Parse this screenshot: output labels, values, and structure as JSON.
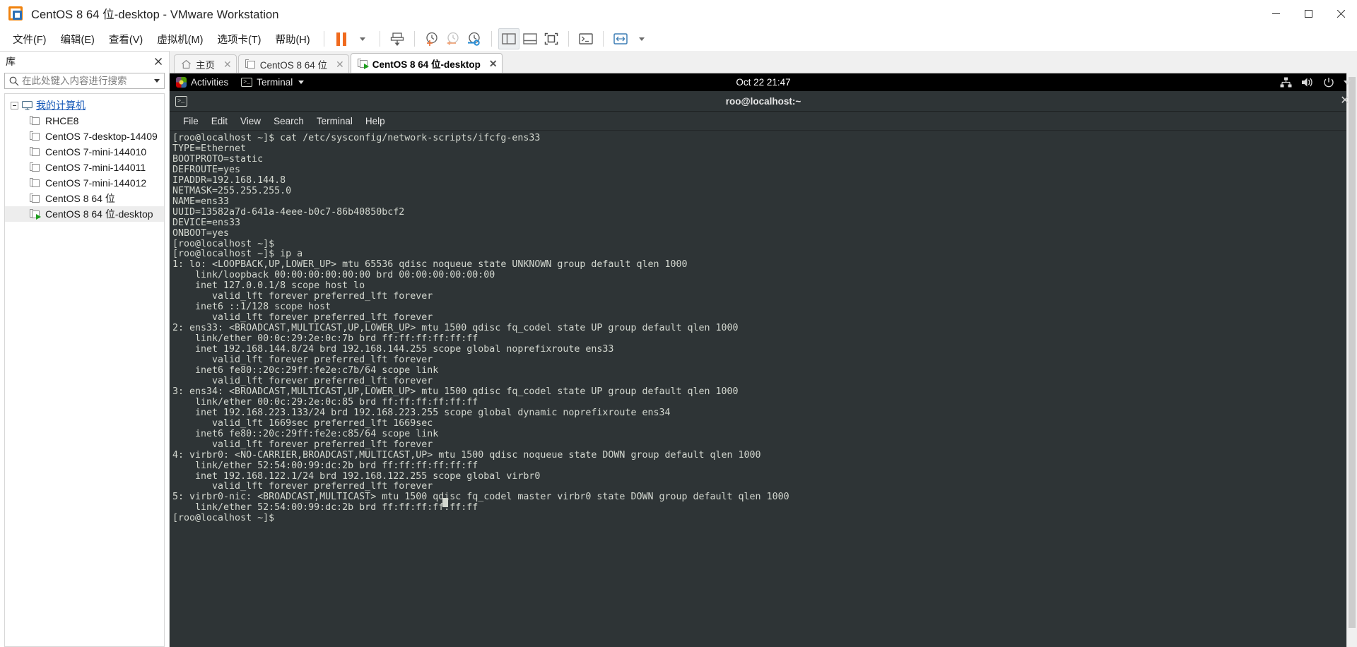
{
  "window": {
    "title": "CentOS 8 64 位-desktop - VMware Workstation",
    "app_icon": "vmware-logo-icon",
    "buttons": {
      "minimize": "minimize-icon",
      "maximize": "maximize-icon",
      "close": "close-icon"
    }
  },
  "menubar": {
    "items": [
      {
        "label": "文件(F)",
        "name": "menu-file"
      },
      {
        "label": "编辑(E)",
        "name": "menu-edit"
      },
      {
        "label": "查看(V)",
        "name": "menu-view"
      },
      {
        "label": "虚拟机(M)",
        "name": "menu-vm"
      },
      {
        "label": "选项卡(T)",
        "name": "menu-tabs"
      },
      {
        "label": "帮助(H)",
        "name": "menu-help"
      }
    ],
    "toolbar": [
      {
        "name": "suspend-button",
        "icon": "pause-icon"
      },
      {
        "name": "power-dropdown",
        "icon": "chevron-down-icon"
      },
      {
        "name": "manage-snapshot-button",
        "icon": "snapshot-save-icon"
      },
      {
        "name": "take-snapshot-button",
        "icon": "clock-plus-icon"
      },
      {
        "name": "revert-snapshot-button",
        "icon": "clock-back-icon"
      },
      {
        "name": "snapshot-manager-button",
        "icon": "clock-wrench-icon"
      },
      {
        "name": "show-library-button",
        "icon": "sidebar-panel-icon"
      },
      {
        "name": "show-console-view-button",
        "icon": "bottom-panel-icon"
      },
      {
        "name": "fullscreen-button",
        "icon": "fullscreen-icon"
      },
      {
        "name": "unity-mode-button",
        "icon": "console-icon"
      },
      {
        "name": "stretch-guest-button",
        "icon": "expand-arrows-icon"
      },
      {
        "name": "stretch-dropdown",
        "icon": "chevron-down-icon"
      }
    ]
  },
  "library": {
    "header": "库",
    "close_icon": "close-icon",
    "search": {
      "placeholder": "在此处键入内容进行搜索",
      "value": "",
      "icon": "search-icon",
      "dropdown_icon": "chevron-down-icon"
    },
    "root": {
      "label": "我的计算机",
      "icon": "computer-icon"
    },
    "items": [
      {
        "label": "RHCE8",
        "running": false
      },
      {
        "label": "CentOS 7-desktop-14409",
        "running": false
      },
      {
        "label": "CentOS 7-mini-144010",
        "running": false
      },
      {
        "label": "CentOS 7-mini-144011",
        "running": false
      },
      {
        "label": "CentOS 7-mini-144012",
        "running": false
      },
      {
        "label": "CentOS 8 64 位",
        "running": false
      },
      {
        "label": "CentOS 8 64 位-desktop",
        "running": true
      }
    ]
  },
  "tabs": [
    {
      "label": "主页",
      "icon": "home-icon",
      "active": false,
      "close_icon": "close-icon"
    },
    {
      "label": "CentOS 8 64 位",
      "icon": "vm-icon",
      "active": false,
      "close_icon": "close-icon"
    },
    {
      "label": "CentOS 8 64 位-desktop",
      "icon": "vm-running-icon",
      "active": true,
      "close_icon": "close-icon"
    }
  ],
  "gnome": {
    "activities": "Activities",
    "app_menu": "Terminal",
    "app_menu_caret": "chevron-down-icon",
    "clock": "Oct 22  21:47",
    "tray": [
      {
        "name": "network-icon"
      },
      {
        "name": "volume-icon"
      },
      {
        "name": "power-icon"
      },
      {
        "name": "chevron-down-icon"
      }
    ]
  },
  "terminal": {
    "title": "roo@localhost:~",
    "title_icon": "terminal-icon",
    "close_icon": "close-icon",
    "menu": [
      "File",
      "Edit",
      "View",
      "Search",
      "Terminal",
      "Help"
    ],
    "content": "[roo@localhost ~]$ cat /etc/sysconfig/network-scripts/ifcfg-ens33\nTYPE=Ethernet\nBOOTPROTO=static\nDEFROUTE=yes\nIPADDR=192.168.144.8\nNETMASK=255.255.255.0\nNAME=ens33\nUUID=13582a7d-641a-4eee-b0c7-86b40850bcf2\nDEVICE=ens33\nONBOOT=yes\n[roo@localhost ~]$ \n[roo@localhost ~]$ ip a\n1: lo: <LOOPBACK,UP,LOWER_UP> mtu 65536 qdisc noqueue state UNKNOWN group default qlen 1000\n    link/loopback 00:00:00:00:00:00 brd 00:00:00:00:00:00\n    inet 127.0.0.1/8 scope host lo\n       valid_lft forever preferred_lft forever\n    inet6 ::1/128 scope host\n       valid_lft forever preferred_lft forever\n2: ens33: <BROADCAST,MULTICAST,UP,LOWER_UP> mtu 1500 qdisc fq_codel state UP group default qlen 1000\n    link/ether 00:0c:29:2e:0c:7b brd ff:ff:ff:ff:ff:ff\n    inet 192.168.144.8/24 brd 192.168.144.255 scope global noprefixroute ens33\n       valid_lft forever preferred_lft forever\n    inet6 fe80::20c:29ff:fe2e:c7b/64 scope link\n       valid_lft forever preferred_lft forever\n3: ens34: <BROADCAST,MULTICAST,UP,LOWER_UP> mtu 1500 qdisc fq_codel state UP group default qlen 1000\n    link/ether 00:0c:29:2e:0c:85 brd ff:ff:ff:ff:ff:ff\n    inet 192.168.223.133/24 brd 192.168.223.255 scope global dynamic noprefixroute ens34\n       valid_lft 1669sec preferred_lft 1669sec\n    inet6 fe80::20c:29ff:fe2e:c85/64 scope link\n       valid_lft forever preferred_lft forever\n4: virbr0: <NO-CARRIER,BROADCAST,MULTICAST,UP> mtu 1500 qdisc noqueue state DOWN group default qlen 1000\n    link/ether 52:54:00:99:dc:2b brd ff:ff:ff:ff:ff:ff\n    inet 192.168.122.1/24 brd 192.168.122.255 scope global virbr0\n       valid_lft forever preferred_lft forever\n5: virbr0-nic: <BROADCAST,MULTICAST> mtu 1500 qdisc fq_codel master virbr0 state DOWN group default qlen 1000\n    link/ether 52:54:00:99:dc:2b brd ff:ff:ff:ff:ff:ff\n[roo@localhost ~]$ "
  },
  "colors": {
    "accent_orange": "#f0820d",
    "accent_blue": "#2b6fb5",
    "terminal_bg": "#2e3436",
    "terminal_fg": "#d3d7cf",
    "gnome_bar_bg": "#000000",
    "link_blue": "#1658b8",
    "running_green": "#1f9e1f"
  }
}
